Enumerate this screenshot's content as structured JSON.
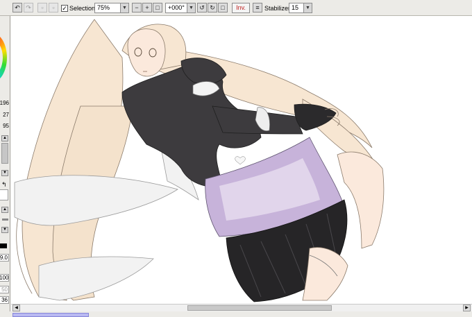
{
  "toolbar": {
    "selection_label": "Selection",
    "selection_checked": "✓",
    "zoom_value": "75%",
    "rotation_value": "+000°",
    "invert_label": "Inv.",
    "stabilizer_label": "Stabilizer",
    "stabilizer_value": "15",
    "dropdown_glyph": "▼"
  },
  "left_panel": {
    "color_value_1": ":196",
    "color_value_2": "27",
    "color_value_3": "95",
    "brush_size": "9.0",
    "density": "100",
    "field_a": "50",
    "field_b": "36"
  },
  "colors": {
    "hair": "#f7e6d2",
    "hair_shadow": "#ead5bb",
    "skin": "#fbe9dc",
    "dress": "#3d3b3e",
    "dress_dark": "#262527",
    "skirt_lilac": "#c7b3da",
    "skirt_light": "#ece4f2",
    "ribbon": "#f2f2f2"
  }
}
